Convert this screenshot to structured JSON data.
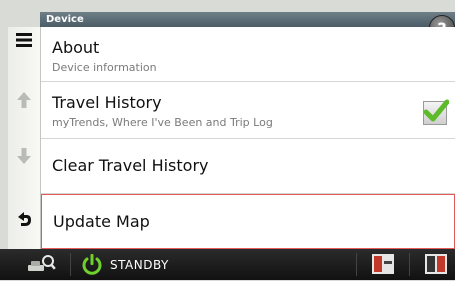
{
  "header": {
    "title": "Device"
  },
  "sidebar": {
    "menu_icon": "menu-icon",
    "up_icon": "arrow-up-icon",
    "down_icon": "arrow-down-icon",
    "back_icon": "back-icon"
  },
  "items": [
    {
      "title": "About",
      "subtitle": "Device information"
    },
    {
      "title": "Travel History",
      "subtitle": "myTrends, Where I've Been and Trip Log",
      "checked": true
    },
    {
      "title": "Clear Travel History"
    },
    {
      "title": "Update Map",
      "selected": true
    }
  ],
  "statusbar": {
    "standby_label": "STANDBY"
  },
  "colors": {
    "checkmark": "#5dbb2a",
    "selection_border": "#e25a5a",
    "header_bg": "#5b6b75"
  }
}
